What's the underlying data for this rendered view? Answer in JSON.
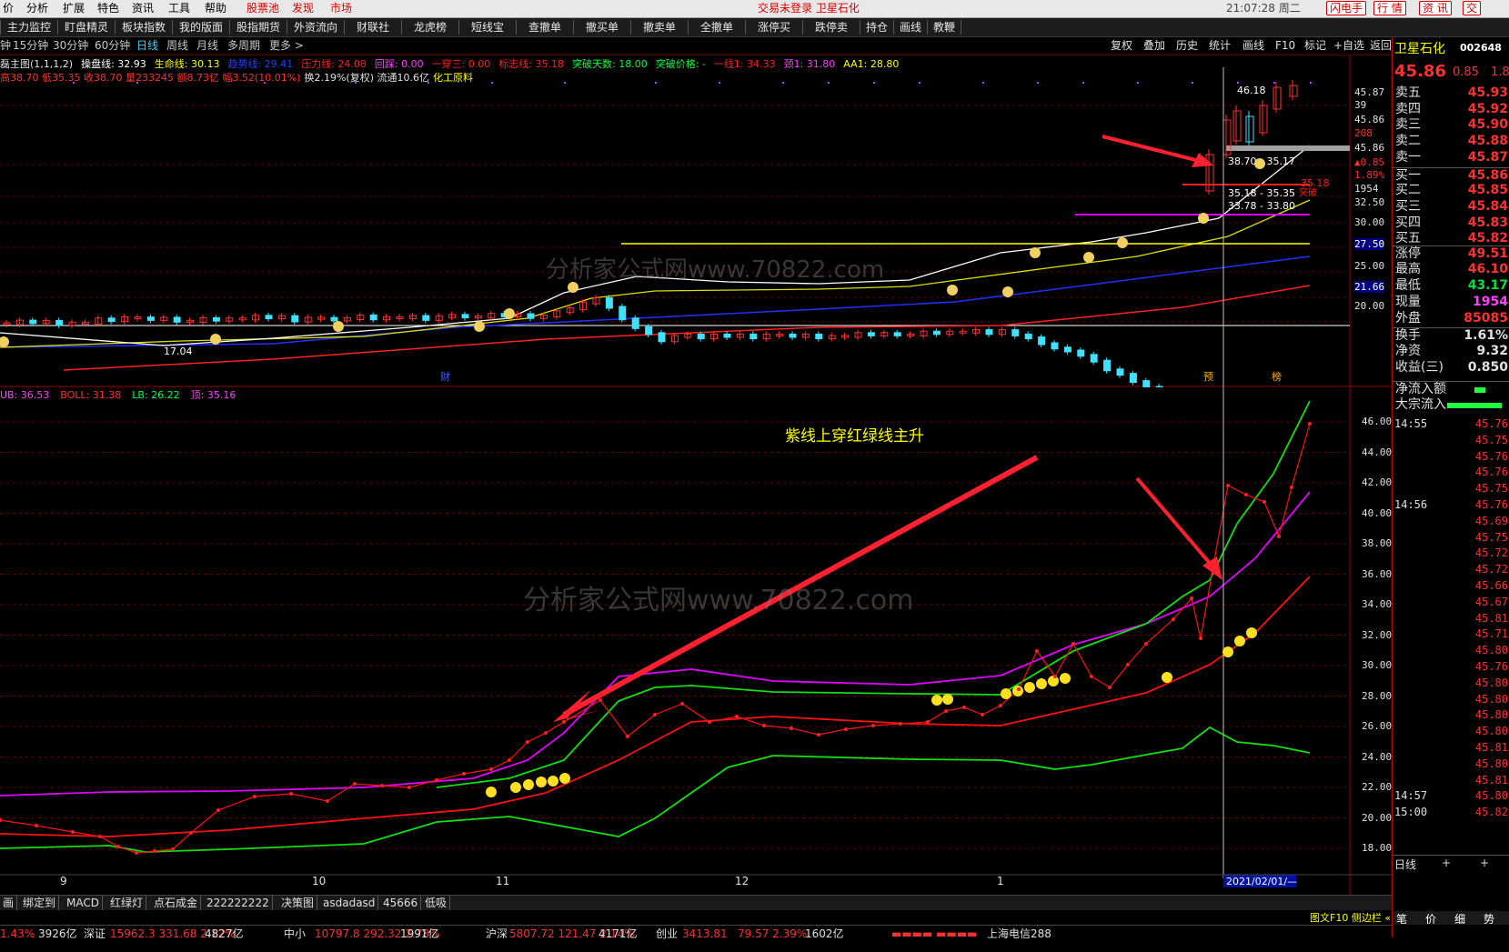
{
  "menu": {
    "items": [
      "价",
      "分析",
      "扩展",
      "特色",
      "资讯",
      "工具",
      "帮助"
    ],
    "highlight": [
      "股票池",
      "发现",
      "市场"
    ],
    "login_status": "交易未登录 卫星石化",
    "clock": "21:07:28 周二",
    "buttons": [
      "闪电手",
      "行 情",
      "资 讯",
      "交"
    ]
  },
  "toolbar": {
    "items": [
      "主力监控",
      "盯盘精灵",
      "板块指数",
      "我的版面",
      "股指期货",
      "外资流向",
      "财联社",
      "龙虎榜",
      "短线宝",
      "查撤单",
      "撤买单",
      "撤卖单",
      "全撤单",
      "涨停买",
      "跌停卖",
      "持仓",
      "画线",
      "教鞭"
    ]
  },
  "period": {
    "items": [
      "钟",
      "15分钟",
      "30分钟",
      "60分钟",
      "日线",
      "周线",
      "月线",
      "多周期",
      "更多 >"
    ],
    "active": "日线",
    "right_buttons": [
      "复权",
      "叠加",
      "历史",
      "统计",
      "画线",
      "F10",
      "标记",
      "+自选",
      "返回"
    ]
  },
  "main_chart": {
    "info_line1": [
      {
        "t": "磊主图(1,1,1,2)",
        "c": "#e0e0e0"
      },
      {
        "t": "操盘线: 32.93",
        "c": "#ffffff"
      },
      {
        "t": "生命线: 30.13",
        "c": "#ffff00"
      },
      {
        "t": "趋势线: 29.41",
        "c": "#2040ff"
      },
      {
        "t": "压力线: 24.08",
        "c": "#ff2020"
      },
      {
        "t": "回踩: 0.00",
        "c": "#ff40ff"
      },
      {
        "t": "一穿三: 0.00",
        "c": "#ff2020"
      },
      {
        "t": "标志线: 35.18",
        "c": "#ff2020"
      },
      {
        "t": "突破天数: 18.00",
        "c": "#00ff40"
      },
      {
        "t": "突破价格: -",
        "c": "#00ff40"
      },
      {
        "t": "一线1: 34.33",
        "c": "#ff2020"
      },
      {
        "t": "颈1: 31.80",
        "c": "#ff40ff"
      },
      {
        "t": "AA1: 28.80",
        "c": "#ffff00"
      }
    ],
    "info_line2": [
      {
        "t": "高38.70 低35.35 收38.70 量233245 额8.73亿 幅3.52(10.01%)",
        "c": "#ff3030"
      },
      {
        "t": "换2.19%(复权) 流通10.6亿",
        "c": "#e0e0e0"
      },
      {
        "t": "化工原料",
        "c": "#ffff00"
      }
    ],
    "y_ticks": [
      "45.87",
      "39",
      "45.86",
      "208",
      "45.86",
      "▲0.85",
      "1.89%",
      "1954",
      "32.50",
      "30.00",
      "27.50",
      "25.00",
      "21.66",
      "20.00"
    ],
    "price_box_labels": [
      "38.70 - 35.17",
      "35.18 - 35.35",
      "33.78 - 33.80",
      "46.18",
      "17.04"
    ],
    "red_notes": [
      "35.18",
      "突破"
    ],
    "markers": [
      "财",
      "预",
      "榜"
    ],
    "watermark": "分析家公式网www.70822.com"
  },
  "sub_chart": {
    "info": [
      {
        "t": "UB: 36.53",
        "c": "#ff40ff"
      },
      {
        "t": "BOLL: 31.38",
        "c": "#ff3030"
      },
      {
        "t": "LB: 26.22",
        "c": "#00ff40"
      },
      {
        "t": "顶: 35.16",
        "c": "#ff40ff"
      }
    ],
    "y_ticks": [
      "46.00",
      "44.00",
      "42.00",
      "40.00",
      "38.00",
      "36.00",
      "34.00",
      "32.00",
      "30.00",
      "28.00",
      "26.00",
      "24.00",
      "22.00",
      "20.00",
      "18.00"
    ],
    "annotation": "紫线上穿红绿线主升",
    "watermark": "分析家公式网www.70822.com",
    "x_ticks": [
      "9",
      "10",
      "11",
      "12",
      "1"
    ],
    "date_label": "2021/02/01/—"
  },
  "bottom_tabs": [
    "画",
    "绑定到",
    "MACD",
    "红绿灯",
    "点石成金",
    "222222222",
    "决策图",
    "asdadasd",
    "45666",
    "低吸"
  ],
  "status_bar": [
    {
      "t": "1.43%",
      "c": "#ff3030"
    },
    {
      "t": "3926亿",
      "c": "#e0e0e0"
    },
    {
      "t": "深证",
      "c": "#e0e0e0"
    },
    {
      "t": "15962.3  331.68  2.12%",
      "c": "#ff3030"
    },
    {
      "t": "4827亿",
      "c": "#e0e0e0"
    },
    {
      "t": "中小",
      "c": "#e0e0e0"
    },
    {
      "t": "10797.8  292.32  2.78%",
      "c": "#ff3030"
    },
    {
      "t": "1991亿",
      "c": "#e0e0e0"
    },
    {
      "t": "沪深",
      "c": "#e0e0e0"
    },
    {
      "t": "5807.72  121.47  2.14%",
      "c": "#ff3030"
    },
    {
      "t": "4171亿",
      "c": "#e0e0e0"
    },
    {
      "t": "创业",
      "c": "#e0e0e0"
    },
    {
      "t": "3413.81",
      "c": "#ff3030"
    },
    {
      "t": "79.57  2.39%",
      "c": "#ff3030"
    },
    {
      "t": "1602亿",
      "c": "#e0e0e0"
    },
    {
      "t": "上海电信288",
      "c": "#e0e0e0"
    }
  ],
  "right_panel": {
    "stock_name": "卫星石化",
    "stock_code": "002648",
    "price": "45.86",
    "change": "0.85",
    "change_pct": "1.8",
    "order_book": [
      {
        "k": "卖五",
        "v": "45.93",
        "c": "#ff3030"
      },
      {
        "k": "卖四",
        "v": "45.92",
        "c": "#ff3030"
      },
      {
        "k": "卖三",
        "v": "45.90",
        "c": "#ff3030"
      },
      {
        "k": "卖二",
        "v": "45.88",
        "c": "#ff3030"
      },
      {
        "k": "卖一",
        "v": "45.87",
        "c": "#ff3030"
      },
      {
        "k": "买一",
        "v": "45.86",
        "c": "#ff3030"
      },
      {
        "k": "买二",
        "v": "45.85",
        "c": "#ff3030"
      },
      {
        "k": "买三",
        "v": "45.84",
        "c": "#ff3030"
      },
      {
        "k": "买四",
        "v": "45.83",
        "c": "#ff3030"
      },
      {
        "k": "买五",
        "v": "45.82",
        "c": "#ff3030"
      }
    ],
    "stats": [
      {
        "k": "涨停",
        "v": "49.51",
        "c": "#ff3030"
      },
      {
        "k": "最高",
        "v": "46.10",
        "c": "#ff3030"
      },
      {
        "k": "最低",
        "v": "43.17",
        "c": "#00e040"
      },
      {
        "k": "现量",
        "v": "1954",
        "c": "#ff40ff"
      },
      {
        "k": "外盘",
        "v": "85085",
        "c": "#ff3030"
      },
      {
        "k": "换手",
        "v": "1.61%",
        "c": "#e0e0e0"
      },
      {
        "k": "净资",
        "v": "9.32",
        "c": "#e0e0e0"
      },
      {
        "k": "收益(三)",
        "v": "0.850",
        "c": "#e0e0e0"
      }
    ],
    "flows": [
      {
        "k": "净流入额"
      },
      {
        "k": "大宗流入"
      }
    ],
    "ticks_a": [
      {
        "time": "14:55",
        "v": "45.76"
      },
      {
        "v": "45.75"
      },
      {
        "v": "45.76"
      },
      {
        "v": "45.76"
      },
      {
        "v": "45.75"
      },
      {
        "time": "14:56",
        "v": "45.76"
      },
      {
        "v": "45.69"
      },
      {
        "v": "45.75"
      },
      {
        "v": "45.72"
      },
      {
        "v": "45.72"
      },
      {
        "v": "45.66"
      },
      {
        "v": "45.67"
      },
      {
        "v": "45.81"
      },
      {
        "v": "45.71"
      },
      {
        "v": "45.80"
      },
      {
        "v": "45.76"
      },
      {
        "v": "45.80"
      },
      {
        "v": "45.80"
      },
      {
        "v": "45.80"
      },
      {
        "v": "45.80"
      },
      {
        "v": "45.81"
      },
      {
        "v": "45.80"
      },
      {
        "v": "45.81"
      },
      {
        "time": "14:57",
        "v": "45.80"
      },
      {
        "time": "15:00",
        "v": "45.82"
      }
    ],
    "tabs": [
      "日线",
      "+",
      "+"
    ],
    "bottom_tabs": [
      "笔",
      "价",
      "细",
      "势"
    ],
    "side_label": "图文F10 侧边栏 «"
  }
}
